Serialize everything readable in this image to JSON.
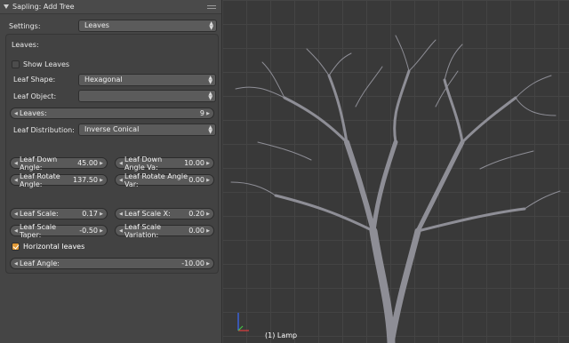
{
  "panel": {
    "title": "Sapling: Add Tree",
    "settings_label": "Settings:",
    "settings_value": "Leaves",
    "section_label": "Leaves:",
    "show_leaves": "Show Leaves",
    "leaf_shape_label": "Leaf Shape:",
    "leaf_shape_value": "Hexagonal",
    "leaf_object_label": "Leaf Object:",
    "leaf_object_value": "",
    "leaves_label": "Leaves:",
    "leaves_value": "9",
    "leaf_distribution_label": "Leaf Distribution:",
    "leaf_distribution_value": "Inverse Conical",
    "fields": {
      "down_angle_label": "Leaf Down Angle:",
      "down_angle_value": "45.00",
      "down_angle_var_label": "Leaf Down Angle Va:",
      "down_angle_var_value": "10.00",
      "rotate_angle_label": "Leaf Rotate Angle:",
      "rotate_angle_value": "137.50",
      "rotate_angle_var_label": "Leaf Rotate Angle Var:",
      "rotate_angle_var_value": "0.00",
      "scale_label": "Leaf Scale:",
      "scale_value": "0.17",
      "scale_x_label": "Leaf Scale X:",
      "scale_x_value": "0.20",
      "scale_taper_label": "Leaf Scale Taper:",
      "scale_taper_value": "-0.50",
      "scale_variation_label": "Leaf Scale Variation:",
      "scale_variation_value": "0.00",
      "leaf_angle_label": "Leaf Angle:",
      "leaf_angle_value": "-10.00"
    },
    "horizontal_leaves": "Horizontal leaves",
    "horizontal_leaves_checked": true,
    "show_leaves_checked": false
  },
  "viewport": {
    "object_label": "(1) Lamp"
  },
  "colors": {
    "panel_bg": "#454545",
    "viewport_bg": "#393939",
    "checkbox_on": "#e29a36",
    "tree": "#8e8e96"
  },
  "icons": [
    "collapse-triangle-icon",
    "panel-grip-icon",
    "dropdown-arrows-icon",
    "left-arrow-icon",
    "right-arrow-icon",
    "axis-gizmo-icon"
  ]
}
